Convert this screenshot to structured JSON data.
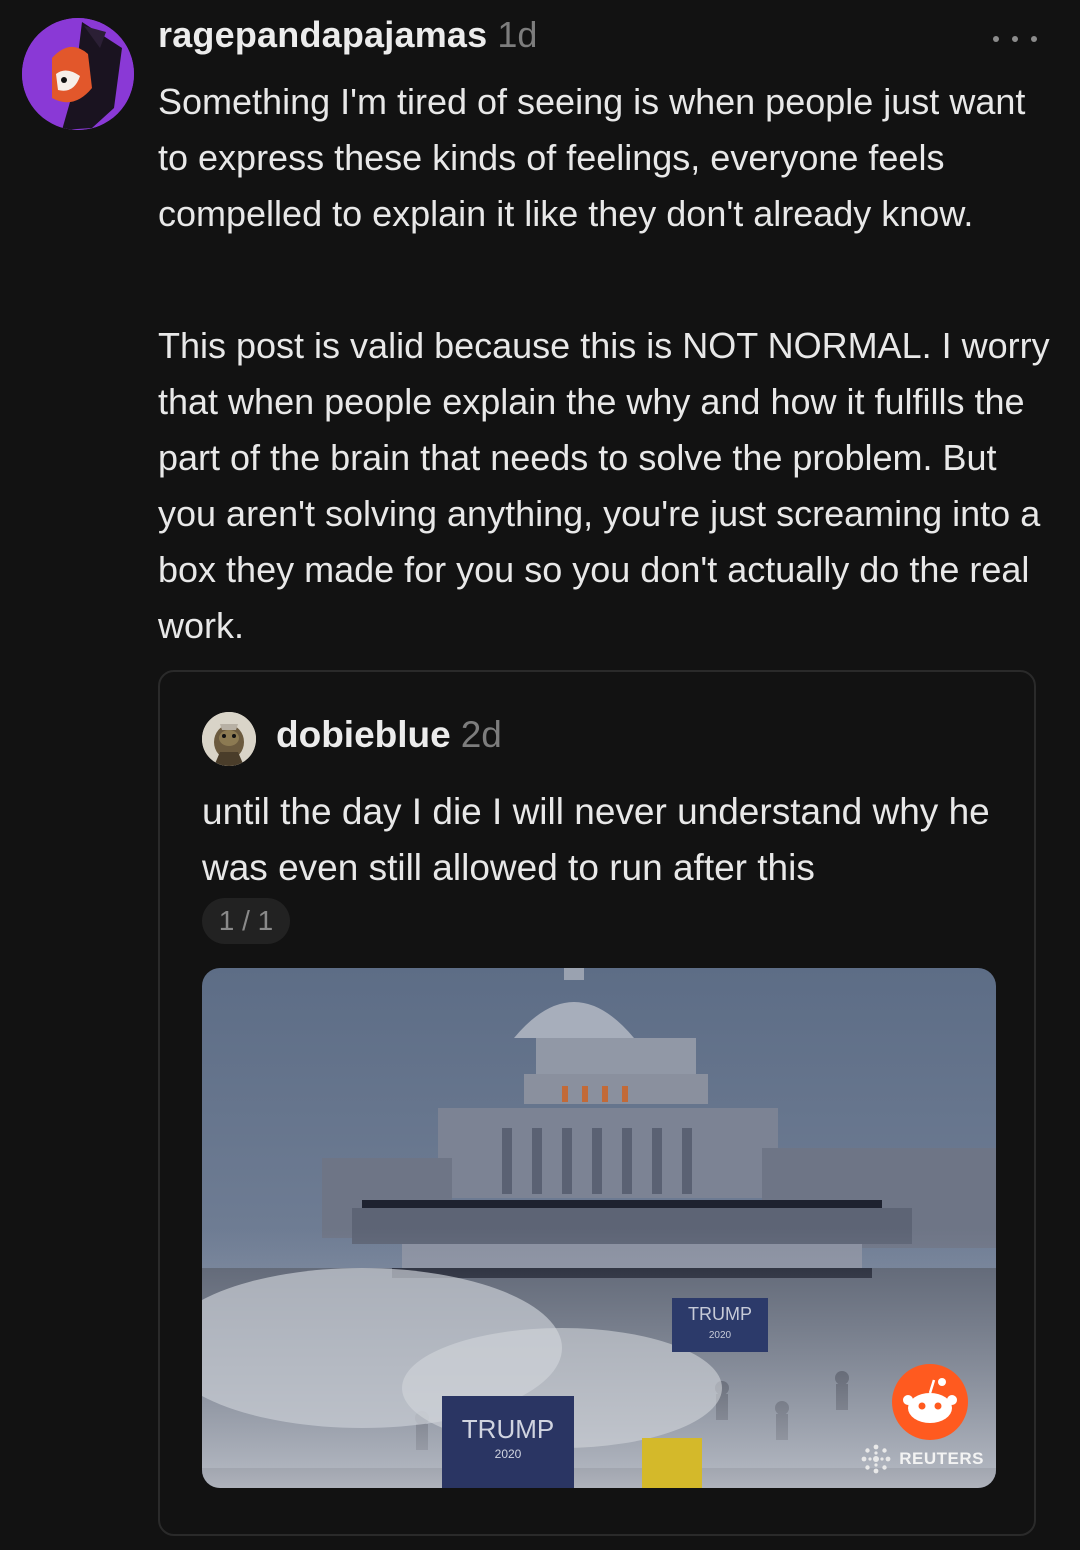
{
  "post": {
    "username": "ragepandapajamas",
    "time": "1d",
    "paragraphs": [
      "Something I'm tired of seeing is when people just want to express these kinds of feelings, everyone feels compelled to explain it like they don't already know.",
      "This post is valid because this is NOT NORMAL. I worry that when people explain the why and how it fulfills the part of the brain that needs to solve the problem. But you aren't solving anything, you're just screaming into a box they made for you so you don't actually do the real work."
    ]
  },
  "quoted": {
    "username": "dobieblue",
    "time": "2d",
    "text": "until the day I die I will never understand why he was even still allowed to run after this",
    "counter": "1 / 1",
    "image": {
      "sign_large": "TRUMP",
      "sign_large_sub": "2020",
      "sign_small": "TRUMP",
      "sign_small_sub": "2020",
      "credit": "REUTERS"
    }
  },
  "colors": {
    "background": "#121212",
    "avatar_accent": "#8a39d6",
    "reddit_orange": "#ff5a1f"
  }
}
